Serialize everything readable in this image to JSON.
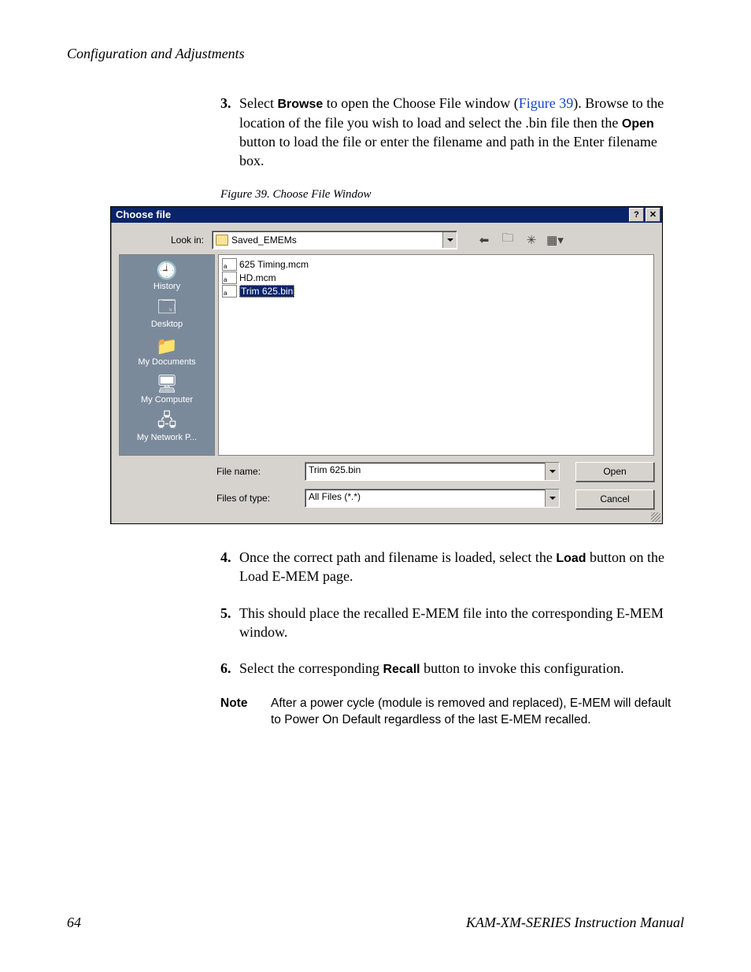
{
  "page": {
    "running_head": "Configuration and Adjustments",
    "page_number": "64",
    "manual_title": "KAM-XM-SERIES Instruction Manual"
  },
  "steps": {
    "s3": {
      "num": "3.",
      "pre": "Select ",
      "browse": "Browse",
      "mid1": " to open the Choose File window (",
      "figref": "Figure 39",
      "mid2": "). Browse to the location of the file you wish to load and select the .bin file then the ",
      "open": "Open",
      "post": " button to load the file or enter the filename and path in the Enter filename box."
    },
    "s4": {
      "num": "4.",
      "pre": "Once the correct path and filename is loaded, select the ",
      "load": "Load",
      "post": " button on the Load E-MEM page."
    },
    "s5": {
      "num": "5.",
      "text": "This should place the recalled E-MEM file into the corresponding E-MEM window."
    },
    "s6": {
      "num": "6.",
      "pre": "Select the corresponding ",
      "recall": "Recall",
      "post": " button to invoke this configuration."
    }
  },
  "figure_caption": "Figure 39.  Choose File Window",
  "note": {
    "label": "Note",
    "text": "After a power cycle (module is removed and replaced), E-MEM will default to Power On Default regardless of the last E-MEM recalled."
  },
  "dialog": {
    "title": "Choose file",
    "help_btn": "?",
    "close_btn": "✕",
    "look_in_label": "Look in:",
    "look_in_value": "Saved_EMEMs",
    "nav": {
      "back": "⬅",
      "up": "🗀",
      "new": "✳",
      "view": "▦"
    },
    "places": {
      "history": "History",
      "desktop": "Desktop",
      "mydocs": "My Documents",
      "mycomp": "My Computer",
      "mynet": "My Network P..."
    },
    "files": {
      "f1": "625 Timing.mcm",
      "f2": "HD.mcm",
      "f3": "Trim 625.bin"
    },
    "file_name_label": "File name:",
    "file_name_value": "Trim 625.bin",
    "file_type_label": "Files of type:",
    "file_type_value": "All Files (*.*)",
    "open_btn": "Open",
    "cancel_btn": "Cancel"
  }
}
